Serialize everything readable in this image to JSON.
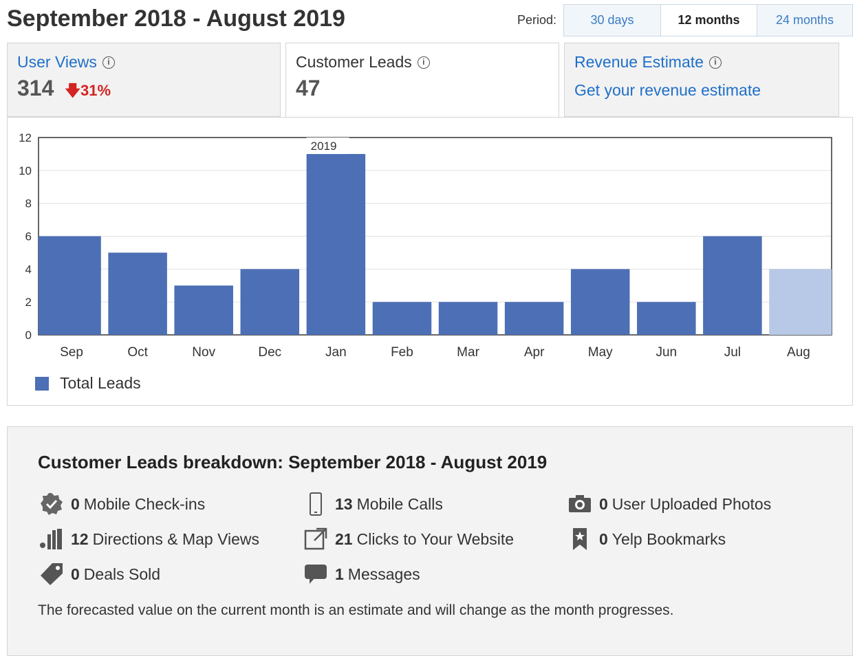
{
  "header": {
    "title": "September 2018 - August 2019",
    "period_label": "Period:",
    "period_tabs": [
      {
        "label": "30 days",
        "active": false
      },
      {
        "label": "12 months",
        "active": true
      },
      {
        "label": "24 months",
        "active": false
      }
    ]
  },
  "stats": {
    "user_views": {
      "label": "User Views",
      "value": "314",
      "change": "31%",
      "direction": "down"
    },
    "customer_leads": {
      "label": "Customer Leads",
      "value": "47"
    },
    "revenue_estimate": {
      "label": "Revenue Estimate",
      "link": "Get your revenue estimate"
    }
  },
  "chart_data": {
    "type": "bar",
    "categories": [
      "Sep",
      "Oct",
      "Nov",
      "Dec",
      "Jan",
      "Feb",
      "Mar",
      "Apr",
      "May",
      "Jun",
      "Jul",
      "Aug"
    ],
    "series": [
      {
        "name": "Total Leads",
        "values": [
          6,
          5,
          3,
          4,
          11,
          2,
          2,
          2,
          4,
          2,
          6,
          4
        ]
      }
    ],
    "ylim": [
      0,
      12
    ],
    "yticks": [
      "0",
      "2",
      "4",
      "6",
      "8",
      "10",
      "12"
    ],
    "annotation": {
      "label": "2019",
      "category": "Jan"
    },
    "forecast_category": "Aug",
    "grid": true,
    "legend_placement": "bottom-left",
    "colors": {
      "bar": "#4c6fb5",
      "forecast": "#b7c9e6",
      "grid": "#e0e0e0",
      "axis": "#333333"
    }
  },
  "legend": {
    "label": "Total Leads"
  },
  "breakdown": {
    "title": "Customer Leads breakdown: September 2018 - August 2019",
    "items": [
      {
        "num": "0",
        "label": "Mobile Check-ins",
        "icon": "check-badge-icon"
      },
      {
        "num": "13",
        "label": "Mobile Calls",
        "icon": "mobile-phone-icon"
      },
      {
        "num": "0",
        "label": "User Uploaded Photos",
        "icon": "camera-icon"
      },
      {
        "num": "12",
        "label": "Directions & Map Views",
        "icon": "map-directions-icon"
      },
      {
        "num": "21",
        "label": "Clicks to Your Website",
        "icon": "external-link-icon"
      },
      {
        "num": "0",
        "label": "Yelp Bookmarks",
        "icon": "bookmark-icon"
      },
      {
        "num": "0",
        "label": "Deals Sold",
        "icon": "tag-icon"
      },
      {
        "num": "1",
        "label": "Messages",
        "icon": "speech-bubble-icon"
      }
    ],
    "footnote": "The forecasted value on the current month is an estimate and will change as the month progresses."
  }
}
